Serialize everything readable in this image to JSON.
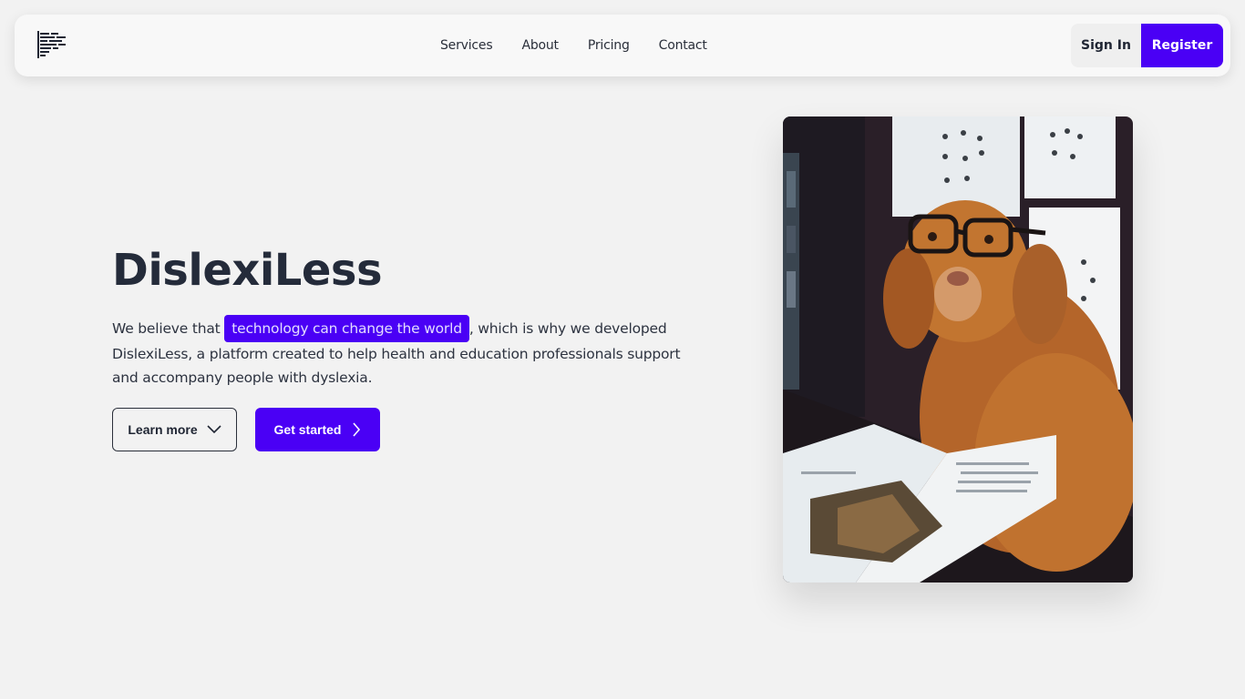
{
  "brand": {
    "logo_icon": "text-lines-icon",
    "accent_color": "#4a00f5"
  },
  "nav": {
    "links": [
      "Services",
      "About",
      "Pricing",
      "Contact"
    ],
    "signin_label": "Sign In",
    "register_label": "Register"
  },
  "hero": {
    "title": "DislexiLess",
    "text_before": "We believe that ",
    "highlight": "technology can change the world",
    "text_after": ", which is why we developed DislexiLess, a platform created to help health and education professionals support and accompany people with dyslexia.",
    "learn_more_label": "Learn more",
    "get_started_label": "Get started",
    "image_subject": "dog-with-glasses-reading-magazine"
  }
}
